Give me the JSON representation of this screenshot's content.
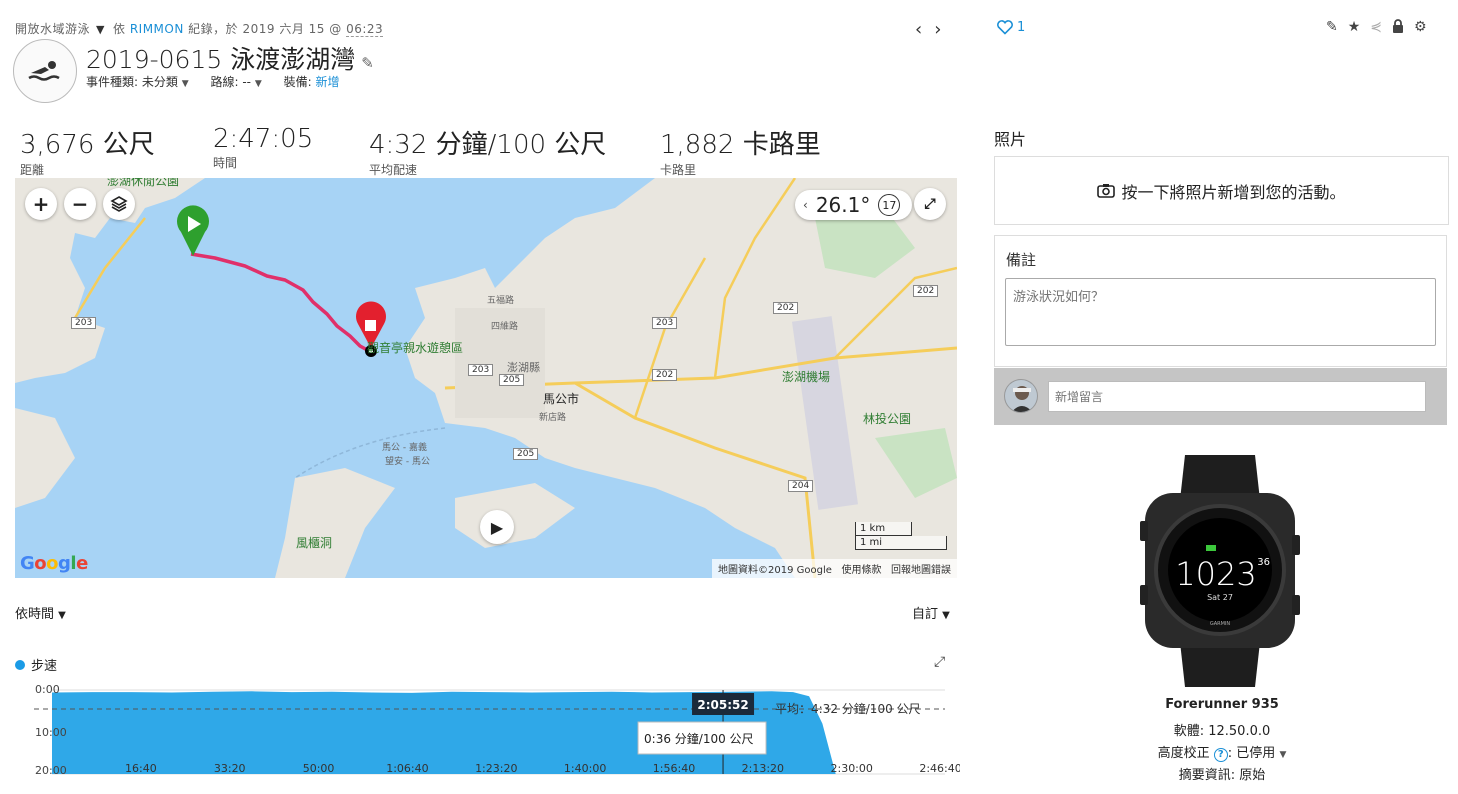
{
  "breadcrumb": {
    "activity_type": "開放水域游泳",
    "by": "依",
    "user": "RIMMON",
    "recorded": "紀錄，於 2019 六月 15 @",
    "time": "06:23"
  },
  "activity": {
    "title": "2019-0615 泳渡澎湖灣",
    "event_type_label": "事件種類:",
    "event_type_value": "未分類",
    "course_label": "路線:",
    "course_value": "--",
    "gear_label": "裝備:",
    "gear_value": "新增"
  },
  "like_count": "1",
  "stats": [
    {
      "value": "3,676 公尺",
      "label": "距離"
    },
    {
      "value": "2:47:05",
      "label": "時間"
    },
    {
      "value": "4:32 分鐘/100 公尺",
      "label": "平均配速"
    },
    {
      "value": "1,882 卡路里",
      "label": "卡路里"
    }
  ],
  "map": {
    "weather_temp": "26.1°",
    "wind_speed": "17",
    "labels": {
      "park_top": "澎湖休閒公園",
      "beach": "觀音亭親水遊憩區",
      "county": "澎湖縣",
      "city": "馬公市",
      "district": "新店路",
      "wugu": "五福路",
      "sanmin": "四維路",
      "airport": "澎湖機場",
      "forest": "林投公園",
      "cave": "風櫃洞",
      "ferry1": "馬公 - 嘉義",
      "ferry2": "望安 - 馬公"
    },
    "roads": [
      "203",
      "203",
      "202",
      "202",
      "202",
      "205",
      "205",
      "204",
      "203"
    ],
    "scale_km": "1 km",
    "scale_mi": "1 mi",
    "google": "Google",
    "attribution": "地圖資料©2019 Google",
    "terms": "使用條款",
    "report": "回報地圖錯誤"
  },
  "chart_controls": {
    "x_mode": "依時間",
    "y_mode": "自訂",
    "series_name": "步速"
  },
  "chart_data": {
    "type": "area",
    "series": [
      {
        "name": "步速",
        "values": [
          0.6,
          0.5,
          0.5,
          0.6,
          0.4,
          0.3,
          0.5,
          0.4,
          0.6,
          0.7,
          0.4,
          0.5,
          0.6,
          0.5,
          0.4,
          0.6,
          0.5,
          0.4,
          0.3,
          0.5,
          1.5,
          8.0,
          20.0
        ]
      }
    ],
    "x": [
      "0:00",
      "7:30",
      "15:00",
      "22:30",
      "30:00",
      "37:30",
      "45:00",
      "52:30",
      "1:00:00",
      "1:07:30",
      "1:15:00",
      "1:22:30",
      "1:30:00",
      "1:37:30",
      "1:45:00",
      "1:52:30",
      "2:00:00",
      "2:07:30",
      "2:15:00",
      "2:19:00",
      "2:22:00",
      "2:24:30",
      "2:27:00"
    ],
    "x_ticks": [
      "16:40",
      "33:20",
      "50:00",
      "1:06:40",
      "1:23:20",
      "1:40:00",
      "1:56:40",
      "2:13:20",
      "2:30:00",
      "2:46:40"
    ],
    "y_ticks": [
      "0:00",
      "10:00",
      "20:00"
    ],
    "ylim": [
      0,
      20
    ],
    "avg_label": "平均：4:32 分鐘/100 公尺",
    "cursor_time": "2:05:52",
    "cursor_value": "0:36 分鐘/100 公尺",
    "color": "#2fa8e8"
  },
  "photos": {
    "heading": "照片",
    "add": "按一下將照片新增到您的活動。"
  },
  "notes": {
    "heading": "備註",
    "placeholder": "游泳狀況如何？"
  },
  "comment": {
    "placeholder": "新增留言"
  },
  "device": {
    "watch_time": "1023",
    "watch_seconds": "36",
    "watch_date": "Sat 27",
    "watch_brand": "GARMIN",
    "name": "Forerunner 935",
    "software": "軟體: 12.50.0.0",
    "elevation_label": "高度校正",
    "elevation_value": ": 已停用",
    "summary": "摘要資訊: 原始"
  }
}
